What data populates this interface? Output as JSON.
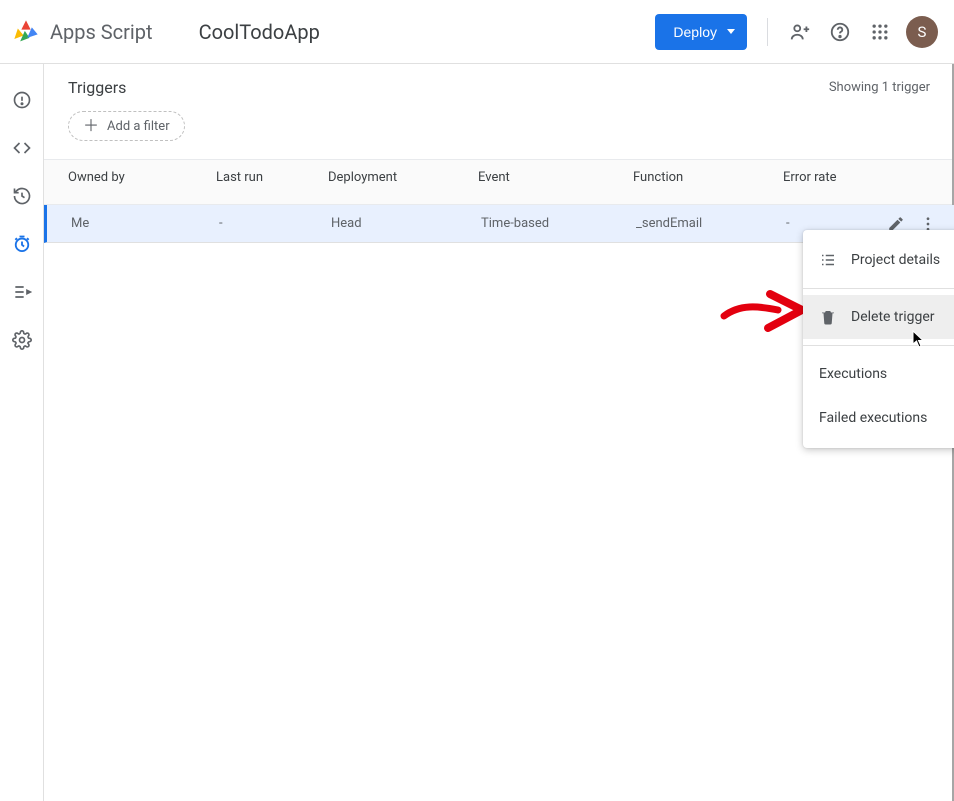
{
  "header": {
    "app_name": "Apps Script",
    "project_name": "CoolTodoApp",
    "deploy_label": "Deploy",
    "avatar_letter": "S"
  },
  "page": {
    "title": "Triggers",
    "count_text": "Showing 1 trigger",
    "add_filter_label": "Add a filter"
  },
  "table": {
    "headers": {
      "owned_by": "Owned by",
      "last_run": "Last run",
      "deployment": "Deployment",
      "event": "Event",
      "function": "Function",
      "error_rate": "Error rate"
    },
    "row": {
      "owned_by": "Me",
      "last_run": "-",
      "deployment": "Head",
      "event": "Time-based",
      "function": "_sendEmail",
      "error_rate": "-"
    }
  },
  "context_menu": {
    "project_details": "Project details",
    "delete_trigger": "Delete trigger",
    "executions": "Executions",
    "failed_executions": "Failed executions"
  }
}
